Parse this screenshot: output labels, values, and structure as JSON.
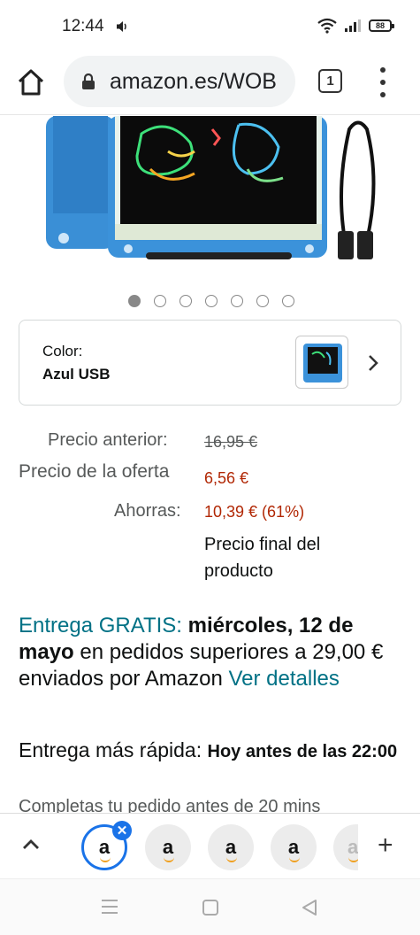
{
  "status_bar": {
    "time": "12:44",
    "battery": "88"
  },
  "browser": {
    "url": "amazon.es/WOB",
    "tab_count": "1"
  },
  "carousel": {
    "count": 7,
    "active_index": 0
  },
  "color_selector": {
    "label": "Color:",
    "value": "Azul USB"
  },
  "pricing": {
    "previous_label": "Precio anterior:",
    "previous_value": "16,95 €",
    "offer_label": "Precio de la oferta",
    "offer_value": "6,56 €",
    "savings_label": "Ahorras:",
    "savings_value": "10,39 € (61%)",
    "final_note": "Precio final del producto"
  },
  "delivery": {
    "free_label": "Entrega GRATIS:",
    "date": "miércoles, 12 de mayo",
    "condition": "en pedidos superiores a 29,00 € enviados por Amazon",
    "details_link": "Ver detalles",
    "fast_label": "Entrega más rápida:",
    "fast_value": "Hoy antes de las 22:00",
    "cutoff": "Completas tu pedido antes de 20 mins"
  },
  "tab_strip": {
    "tab_letter": "a",
    "close_glyph": "✕",
    "add_glyph": "+"
  },
  "colors": {
    "link_teal": "#007185",
    "price_red": "#b12704",
    "accent_blue": "#1a73e8"
  }
}
